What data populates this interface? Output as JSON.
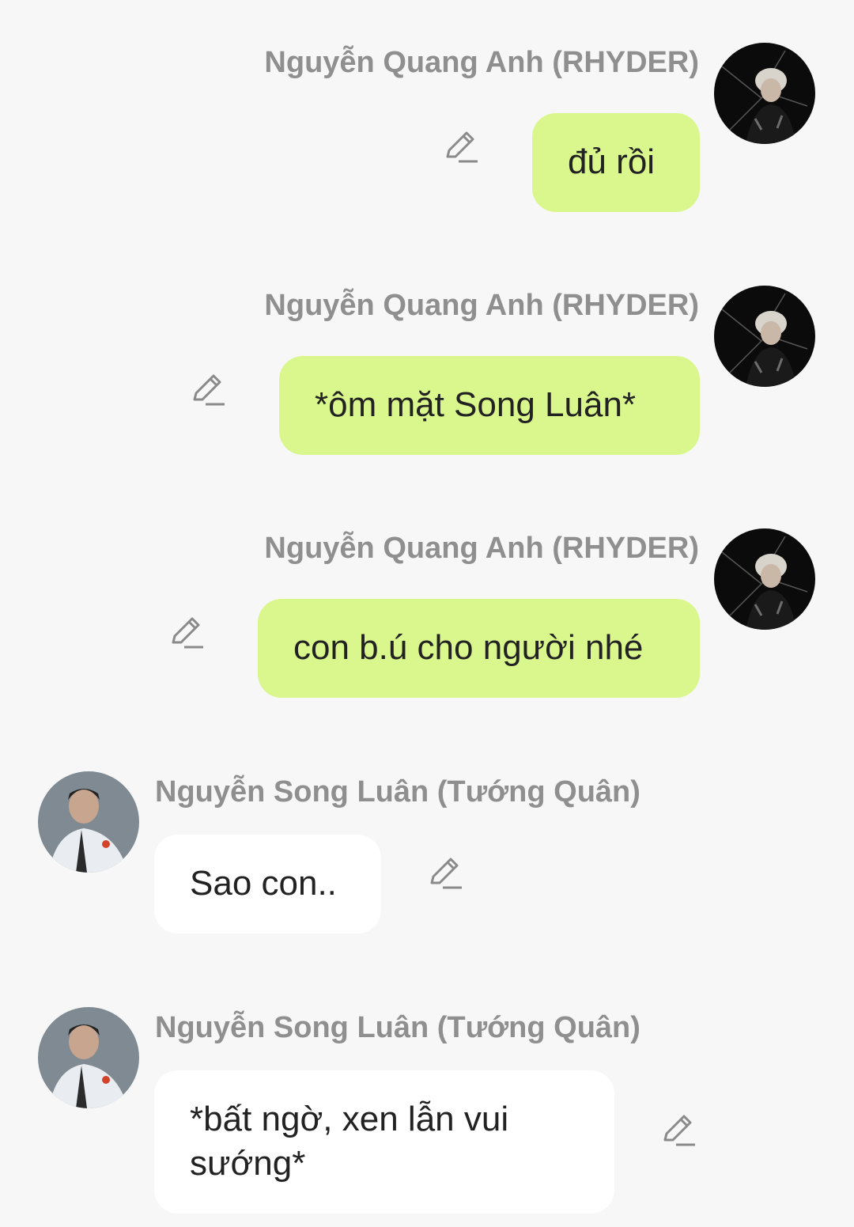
{
  "colors": {
    "background": "#f7f7f7",
    "outgoing_bubble": "#d9f78c",
    "incoming_bubble": "#ffffff",
    "sender_text": "#8f8f8f",
    "message_text": "#222222"
  },
  "messages": [
    {
      "direction": "outgoing",
      "sender": "Nguyễn Quang Anh (RHYDER)",
      "text": "đủ rồi",
      "avatar_icon": "avatar-rhyder",
      "action_icon": "pencil-edit-icon"
    },
    {
      "direction": "outgoing",
      "sender": "Nguyễn Quang Anh (RHYDER)",
      "text": "*ôm mặt Song Luân*",
      "avatar_icon": "avatar-rhyder",
      "action_icon": "pencil-edit-icon"
    },
    {
      "direction": "outgoing",
      "sender": "Nguyễn Quang Anh (RHYDER)",
      "text": "con b.ú cho người nhé",
      "avatar_icon": "avatar-rhyder",
      "action_icon": "pencil-edit-icon"
    },
    {
      "direction": "incoming",
      "sender": "Nguyễn Song Luân (Tướng Quân)",
      "text": "Sao con..",
      "avatar_icon": "avatar-song-luan",
      "action_icon": "pencil-edit-icon"
    },
    {
      "direction": "incoming",
      "sender": "Nguyễn Song Luân (Tướng Quân)",
      "text": "*bất ngờ, xen lẫn vui sướng*",
      "avatar_icon": "avatar-song-luan",
      "action_icon": "pencil-edit-icon"
    }
  ]
}
